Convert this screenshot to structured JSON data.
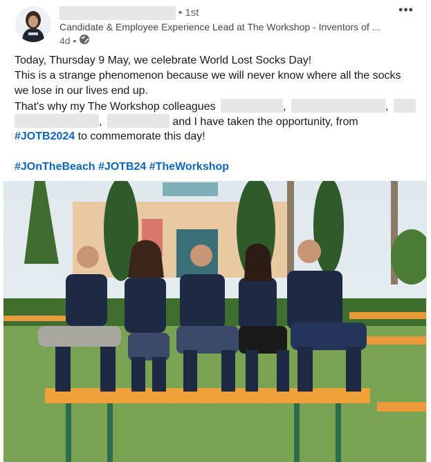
{
  "post": {
    "degree": "• 1st",
    "headline": "Candidate & Employee Experience Lead at The Workshop - Inventors of ...",
    "time": "4d •",
    "menu_label": "•••",
    "body": {
      "line1": "Today, Thursday 9 May, we celebrate World Lost Socks Day!",
      "line2": "This is a strange phenomenon because we will never know where all the socks",
      "line3": "we lose in our lives end up.",
      "line4_start": "That's why my The Workshop colleagues",
      "comma": ",",
      "line5_end": "and I have taken the opportunity, from",
      "line6_tag": "#JOTB2024",
      "line6_rest": "to commemorate this day!"
    },
    "hashtags": [
      "#JOnTheBeach",
      "#JOTB24",
      "#TheWorkshop"
    ]
  },
  "colors": {
    "link": "#0a66c2",
    "redaction": "#e6e6e6",
    "text": "#191919",
    "muted": "#666666"
  },
  "icons": {
    "visibility": "globe-icon",
    "more": "more-icon"
  }
}
